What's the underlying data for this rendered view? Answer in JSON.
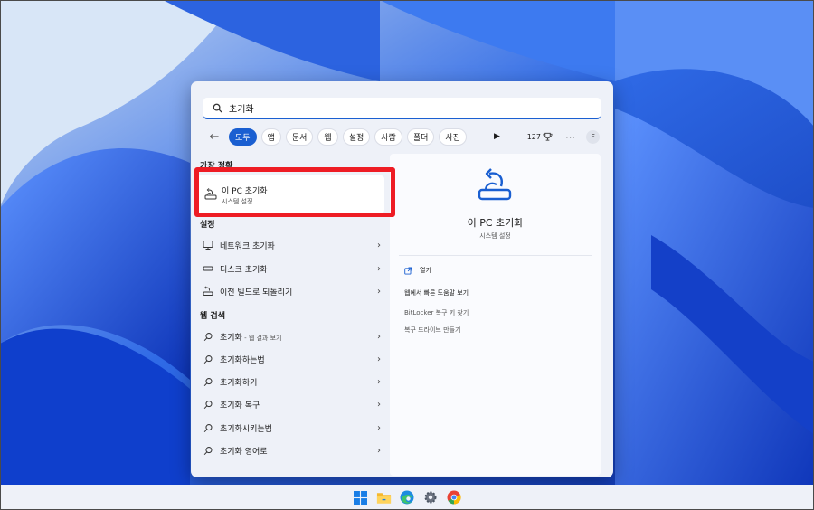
{
  "search": {
    "query": "초기화"
  },
  "filters": {
    "chips": [
      "모두",
      "앱",
      "문서",
      "웹",
      "설정",
      "사람",
      "폴더",
      "사진"
    ],
    "active": "모두",
    "count": "127"
  },
  "account": {
    "initial": "F"
  },
  "best_match": {
    "section": "가장 정확",
    "title": "이 PC 초기화",
    "subtitle": "시스템 설정"
  },
  "settings": {
    "section": "설정",
    "items": [
      {
        "label": "네트워크 초기화",
        "icon": "network-icon"
      },
      {
        "label": "디스크 초기화",
        "icon": "disk-icon"
      },
      {
        "label": "이전 빌드로 되돌리기",
        "icon": "recovery-icon"
      }
    ]
  },
  "web": {
    "section": "웹 검색",
    "items": [
      {
        "label": "초기화",
        "suffix": " - 웹 결과 보기"
      },
      {
        "label": "초기화하는법",
        "suffix": ""
      },
      {
        "label": "초기화하기",
        "suffix": ""
      },
      {
        "label": "초기화 복구",
        "suffix": ""
      },
      {
        "label": "초기화시키는법",
        "suffix": ""
      },
      {
        "label": "초기화 영어로",
        "suffix": ""
      }
    ]
  },
  "preview": {
    "title": "이 PC 초기화",
    "subtitle": "시스템 설정",
    "actions": [
      "열기",
      "웹에서 빠른 도움말 보기",
      "BitLocker 복구 키 찾기",
      "복구 드라이브 만들기"
    ]
  },
  "colors": {
    "accent": "#1a5fd1",
    "highlight": "#ee1c24",
    "panel": "#eef1f8",
    "wallpaper": "#1f4fd6"
  },
  "taskbar": {
    "icons": [
      "start-icon",
      "file-explorer-icon",
      "edge-icon",
      "settings-icon",
      "chrome-icon"
    ]
  }
}
